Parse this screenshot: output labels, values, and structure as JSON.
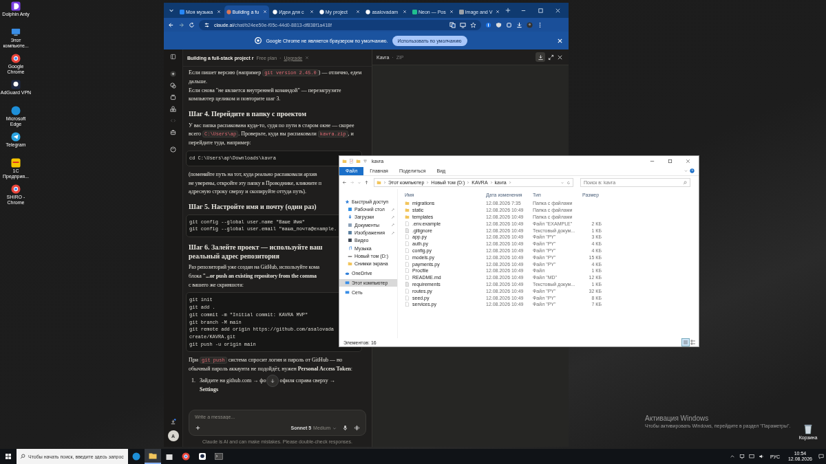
{
  "desktop": {
    "icons": [
      {
        "label": "Dolphin Anty",
        "kind": "dolphin"
      },
      {
        "label": "Этот компьюте...",
        "kind": "pc"
      },
      {
        "label": "Google Chrome",
        "kind": "chrome"
      },
      {
        "label": "AdGuard VPN",
        "kind": "adguard"
      },
      {
        "label": "Microsoft Edge",
        "kind": "edge"
      },
      {
        "label": "Telegram",
        "kind": "telegram"
      },
      {
        "label": "1С Предприя...",
        "kind": "onec"
      },
      {
        "label": "SHIRO - Chrome",
        "kind": "chrome"
      }
    ],
    "recycle_bin": "Корзина",
    "activation": {
      "title": "Активация Windows",
      "text": "Чтобы активировать Windows, перейдите в раздел \"Параметры\"."
    }
  },
  "browser": {
    "tabs": [
      {
        "label": "Моя музыка",
        "kind": "vk",
        "selected": false
      },
      {
        "label": "Building a fu",
        "kind": "claude",
        "selected": true
      },
      {
        "label": "Идеи для с",
        "kind": "chat",
        "selected": false
      },
      {
        "label": "My project",
        "kind": "project",
        "selected": false
      },
      {
        "label": "asalovadam",
        "kind": "github",
        "selected": false
      },
      {
        "label": "Neon — Pos",
        "kind": "neon",
        "selected": false
      },
      {
        "label": "Image and V",
        "kind": "image",
        "selected": false
      }
    ],
    "address": {
      "host": "claude.ai",
      "path": "/chat/b24ee50e-f05c-44d0-8813-df838f1a418f"
    },
    "infobar": {
      "text": "Google Chrome не является браузером по умолчанию.",
      "button": "Использовать по умолчанию"
    }
  },
  "claude": {
    "title": "Building a full-stack project r",
    "plan": "Free plan",
    "separator": "·",
    "upgrade": "Upgrade",
    "avatar": "A",
    "blocks": [
      {
        "kind": "p",
        "segments": [
          {
            "kind": "text",
            "text": "Если пишет версию (например "
          },
          {
            "kind": "code",
            "text": "git version 2.45.0"
          },
          {
            "kind": "text",
            "text": ") — отлично, едем дальше."
          },
          {
            "kind": "break"
          },
          {
            "kind": "text",
            "text": "Если снова \"не является внутренней командой\" — перезагрузите компьютер целиком и повторите шаг 3."
          }
        ]
      },
      {
        "kind": "h",
        "text": "Шаг 4. Перейдите в папку с проектом"
      },
      {
        "kind": "p",
        "segments": [
          {
            "kind": "text",
            "text": "У вас папка распакована куда-то, судя по пути в старом окне — скорее всего "
          },
          {
            "kind": "code",
            "text": "C:\\Users\\ap"
          },
          {
            "kind": "text",
            "text": ". Проверьте, куда вы распаковали "
          },
          {
            "kind": "code",
            "text": "kavra.zip"
          },
          {
            "kind": "text",
            "text": ", и перейдите туда, например:"
          }
        ]
      },
      {
        "kind": "code",
        "lines": [
          "cd C:\\Users\\ap\\Downloads\\kavra"
        ]
      },
      {
        "kind": "lines",
        "lines": [
          "(поменяйте путь на тот, куда реально распаковали архив",
          "не уверены, откройте эту папку в Проводнике, кликните п",
          "адресную строку сверху и скопируйте оттуда путь)."
        ]
      },
      {
        "kind": "h",
        "text": "Шаг 5. Настройте имя и почту (один раз)"
      },
      {
        "kind": "code",
        "lines": [
          "git config --global user.name \"Ваше Имя\"",
          "git config --global user.email \"ваша_почта@example."
        ]
      },
      {
        "kind": "h",
        "text": "Шаг 6. Залейте проект — используйте ваш реальный адрес репозитория"
      },
      {
        "kind": "lines",
        "lines": [
          "Раз репозиторий уже создан на GitHub, используйте кома",
          "блока **\"...or push an existing repository from the comma**",
          "с вашего же скриншота:"
        ]
      },
      {
        "kind": "code",
        "lines": [
          "git init",
          "git add .",
          "git commit -m \"Initial commit: KAVRA MVP\"",
          "git branch -M main",
          "git remote add origin https://github.com/asalovada",
          "create/KAVRA.git",
          "git push -u origin main"
        ]
      },
      {
        "kind": "p",
        "segments": [
          {
            "kind": "text",
            "text": "При "
          },
          {
            "kind": "code",
            "text": "git push"
          },
          {
            "kind": "text",
            "text": " система спросит логин и пароль от GitHub — но обычный пароль аккаунта не подойдёт, нужен **Personal Access Token**:"
          }
        ]
      },
      {
        "kind": "li",
        "number": "1.",
        "before": "Зайдите на github.com → фо",
        "after": "офиля справа сверху →",
        "tail": "Settings"
      }
    ],
    "composer": {
      "placeholder": "Write a message...",
      "model": "Sonnet 5",
      "effort": "Medium"
    },
    "disclaimer": "Claude is AI and can make mistakes. Please double-check responses.",
    "artifact": {
      "title": "Kavra",
      "separator": "·",
      "type": "ZIP"
    }
  },
  "explorer": {
    "title": "kavra",
    "ribbon": [
      {
        "label": "Файл",
        "kind": "file"
      },
      {
        "label": "Главная",
        "kind": "tab"
      },
      {
        "label": "Поделиться",
        "kind": "tab"
      },
      {
        "label": "Вид",
        "kind": "tab"
      }
    ],
    "path": [
      "Этот компьютер",
      "Новый том (D:)",
      "KAVRA",
      "kavra"
    ],
    "search": {
      "placeholder": "Поиск в: kavra"
    },
    "nav": [
      {
        "label": "Быстрый доступ",
        "kind": "star",
        "selected": false,
        "children": [
          {
            "label": "Рабочий стол",
            "kind": "desktop",
            "selected": false,
            "pinned": true
          },
          {
            "label": "Загрузки",
            "kind": "download",
            "selected": false,
            "pinned": true
          },
          {
            "label": "Документы",
            "kind": "docs",
            "selected": false,
            "pinned": true
          },
          {
            "label": "Изображения",
            "kind": "pictures",
            "selected": false,
            "pinned": true
          },
          {
            "label": "Видео",
            "kind": "video",
            "selected": false,
            "pinned": false
          },
          {
            "label": "Музыка",
            "kind": "music",
            "selected": false,
            "pinned": false
          },
          {
            "label": "Новый том (D:)",
            "kind": "drive",
            "selected": false,
            "pinned": false
          },
          {
            "label": "Снимки экрана",
            "kind": "folder",
            "selected": false,
            "pinned": false
          }
        ]
      },
      {
        "label": "OneDrive",
        "kind": "cloud",
        "selected": false
      },
      {
        "label": "Этот компьютер",
        "kind": "pc",
        "selected": true
      },
      {
        "label": "Сеть",
        "kind": "network",
        "selected": false
      }
    ],
    "columns": [
      "Имя",
      "Дата изменения",
      "Тип",
      "Размер"
    ],
    "rows": [
      {
        "name": "migrations",
        "date": "12.08.2026 7:35",
        "type": "Папка с файлами",
        "size": "",
        "kind": "folder"
      },
      {
        "name": "static",
        "date": "12.08.2026 10:49",
        "type": "Папка с файлами",
        "size": "",
        "kind": "folder"
      },
      {
        "name": "templates",
        "date": "12.08.2026 10:49",
        "type": "Папка с файлами",
        "size": "",
        "kind": "folder"
      },
      {
        "name": ".env.example",
        "date": "12.08.2026 10:49",
        "type": "Файл \"EXAMPLE\"",
        "size": "2 КБ",
        "kind": "file"
      },
      {
        "name": ".gitignore",
        "date": "12.08.2026 10:49",
        "type": "Текстовый докум...",
        "size": "1 КБ",
        "kind": "text"
      },
      {
        "name": "app.py",
        "date": "12.08.2026 10:49",
        "type": "Файл \"PY\"",
        "size": "3 КБ",
        "kind": "file"
      },
      {
        "name": "auth.py",
        "date": "12.08.2026 10:49",
        "type": "Файл \"PY\"",
        "size": "4 КБ",
        "kind": "file"
      },
      {
        "name": "config.py",
        "date": "12.08.2026 10:49",
        "type": "Файл \"PY\"",
        "size": "4 КБ",
        "kind": "file"
      },
      {
        "name": "models.py",
        "date": "12.08.2026 10:49",
        "type": "Файл \"PY\"",
        "size": "15 КБ",
        "kind": "file"
      },
      {
        "name": "payments.py",
        "date": "12.08.2026 10:49",
        "type": "Файл \"PY\"",
        "size": "4 КБ",
        "kind": "file"
      },
      {
        "name": "Procfile",
        "date": "12.08.2026 10:49",
        "type": "Файл",
        "size": "1 КБ",
        "kind": "file"
      },
      {
        "name": "README.md",
        "date": "12.08.2026 10:49",
        "type": "Файл \"MD\"",
        "size": "12 КБ",
        "kind": "file"
      },
      {
        "name": "requirements",
        "date": "12.08.2026 10:49",
        "type": "Текстовый докум...",
        "size": "1 КБ",
        "kind": "text"
      },
      {
        "name": "routes.py",
        "date": "12.08.2026 10:49",
        "type": "Файл \"PY\"",
        "size": "32 КБ",
        "kind": "file"
      },
      {
        "name": "seed.py",
        "date": "12.08.2026 10:49",
        "type": "Файл \"PY\"",
        "size": "8 КБ",
        "kind": "file"
      },
      {
        "name": "services.py",
        "date": "12.08.2026 10:49",
        "type": "Файл \"PY\"",
        "size": "7 КБ",
        "kind": "file"
      }
    ],
    "status": "Элементов: 16",
    "views": [
      {
        "kind": "details",
        "selected": true
      },
      {
        "kind": "tiles",
        "selected": false
      }
    ]
  },
  "taskbar": {
    "search": {
      "placeholder": "Чтобы начать поиск, введите здесь запрос"
    },
    "apps": [
      {
        "kind": "edge",
        "active": false
      },
      {
        "kind": "explorer",
        "active": true
      },
      {
        "kind": "store",
        "active": false
      },
      {
        "kind": "chrome",
        "active": false
      },
      {
        "kind": "adguard",
        "active": false
      },
      {
        "kind": "terminal",
        "active": false
      }
    ],
    "language": "РУС",
    "time": "10:54",
    "date": "12.08.2026"
  }
}
